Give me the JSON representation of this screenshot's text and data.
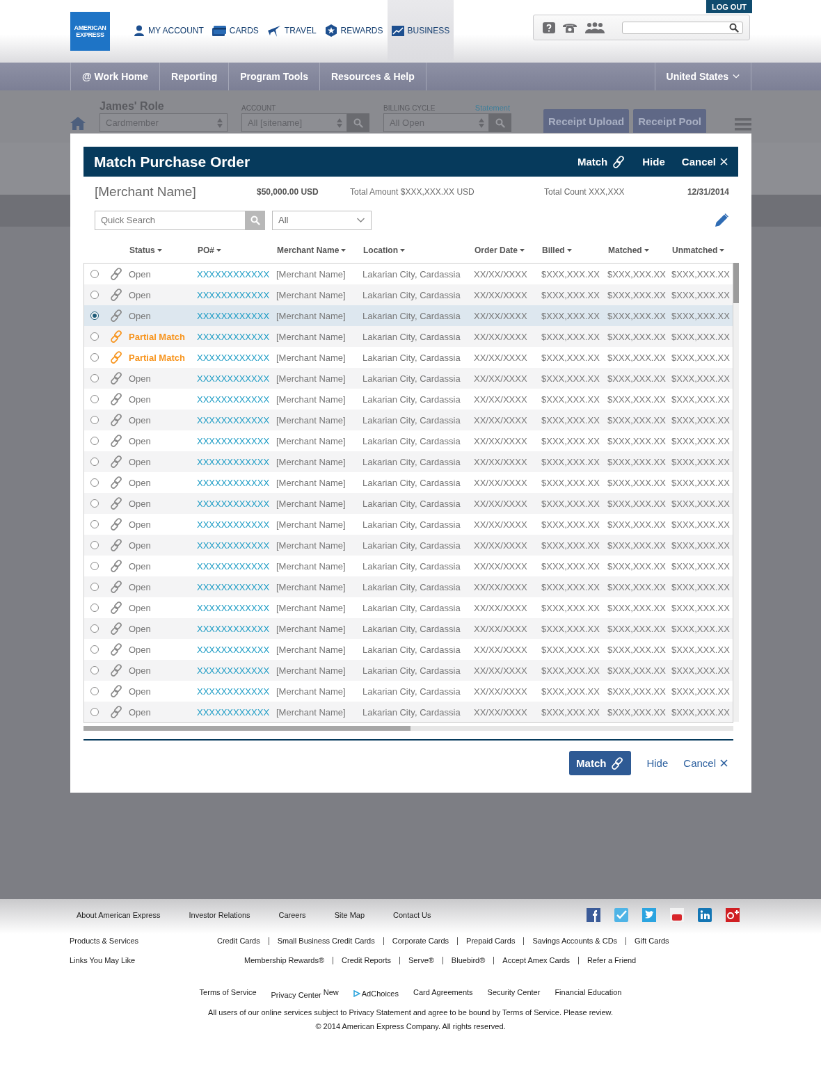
{
  "header": {
    "logo": [
      "AMERICAN",
      "EXPRESS"
    ],
    "logout": "LOG OUT",
    "nav": [
      {
        "label": "MY ACCOUNT",
        "selected": false
      },
      {
        "label": "CARDS",
        "selected": false
      },
      {
        "label": "TRAVEL",
        "selected": false
      },
      {
        "label": "REWARDS",
        "selected": false
      },
      {
        "label": "BUSINESS",
        "selected": true
      }
    ]
  },
  "main_nav": {
    "items": [
      "@ Work Home",
      "Reporting",
      "Program Tools",
      "Resources & Help"
    ],
    "region": "United States"
  },
  "toolbar": {
    "role_title": "James' Role",
    "role_select": "Cardmember",
    "account_label": "ACCOUNT",
    "account_select": "All [sitename]",
    "billing_label": "BILLING CYCLE",
    "statement_link": "Statement",
    "billing_select": "All Open",
    "buttons": [
      "Receipt Upload",
      "Receipt Pool"
    ]
  },
  "modal": {
    "title": "Match Purchase Order",
    "actions": [
      {
        "label": "Match",
        "kind": "link-icon"
      },
      {
        "label": "Hide",
        "kind": "plain"
      },
      {
        "label": "Cancel",
        "kind": "cancel"
      }
    ],
    "summary": {
      "merchant": "[Merchant Name]",
      "amount": "$50,000.00 USD",
      "total_amount": "Total Amount $XXX,XXX.XX USD",
      "total_count": "Total Count XXX,XXX",
      "date": "12/31/2014"
    },
    "search": {
      "placeholder": "Quick Search"
    },
    "filter": "All",
    "columns": [
      "Status",
      "PO#",
      "Merchant Name",
      "Location",
      "Order Date",
      "Billed",
      "Matched",
      "Unmatched"
    ],
    "rows": [
      {
        "selected": false,
        "kind": "open",
        "status": "Open",
        "po": "XXXXXXXXXXXX",
        "merchant": "[Merchant Name]",
        "location": "Lakarian City, Cardassia",
        "order_date": "XX/XX/XXXX",
        "billed": "$XXX,XXX.XX",
        "matched": "$XXX,XXX.XX",
        "unmatched": "$XXX,XXX.XX"
      },
      {
        "selected": false,
        "kind": "open",
        "status": "Open",
        "po": "XXXXXXXXXXXX",
        "merchant": "[Merchant Name]",
        "location": "Lakarian City, Cardassia",
        "order_date": "XX/XX/XXXX",
        "billed": "$XXX,XXX.XX",
        "matched": "$XXX,XXX.XX",
        "unmatched": "$XXX,XXX.XX"
      },
      {
        "selected": true,
        "kind": "open",
        "status": "Open",
        "po": "XXXXXXXXXXXX",
        "merchant": "[Merchant Name]",
        "location": "Lakarian City, Cardassia",
        "order_date": "XX/XX/XXXX",
        "billed": "$XXX,XXX.XX",
        "matched": "$XXX,XXX.XX",
        "unmatched": "$XXX,XXX.XX"
      },
      {
        "selected": false,
        "kind": "partial",
        "status": "Partial Match",
        "po": "XXXXXXXXXXXX",
        "merchant": "[Merchant Name]",
        "location": "Lakarian City, Cardassia",
        "order_date": "XX/XX/XXXX",
        "billed": "$XXX,XXX.XX",
        "matched": "$XXX,XXX.XX",
        "unmatched": "$XXX,XXX.XX"
      },
      {
        "selected": false,
        "kind": "partial",
        "status": "Partial Match",
        "po": "XXXXXXXXXXXX",
        "merchant": "[Merchant Name]",
        "location": "Lakarian City, Cardassia",
        "order_date": "XX/XX/XXXX",
        "billed": "$XXX,XXX.XX",
        "matched": "$XXX,XXX.XX",
        "unmatched": "$XXX,XXX.XX"
      },
      {
        "selected": false,
        "kind": "open",
        "status": "Open",
        "po": "XXXXXXXXXXXX",
        "merchant": "[Merchant Name]",
        "location": "Lakarian City, Cardassia",
        "order_date": "XX/XX/XXXX",
        "billed": "$XXX,XXX.XX",
        "matched": "$XXX,XXX.XX",
        "unmatched": "$XXX,XXX.XX"
      },
      {
        "selected": false,
        "kind": "open",
        "status": "Open",
        "po": "XXXXXXXXXXXX",
        "merchant": "[Merchant Name]",
        "location": "Lakarian City, Cardassia",
        "order_date": "XX/XX/XXXX",
        "billed": "$XXX,XXX.XX",
        "matched": "$XXX,XXX.XX",
        "unmatched": "$XXX,XXX.XX"
      },
      {
        "selected": false,
        "kind": "open",
        "status": "Open",
        "po": "XXXXXXXXXXXX",
        "merchant": "[Merchant Name]",
        "location": "Lakarian City, Cardassia",
        "order_date": "XX/XX/XXXX",
        "billed": "$XXX,XXX.XX",
        "matched": "$XXX,XXX.XX",
        "unmatched": "$XXX,XXX.XX"
      },
      {
        "selected": false,
        "kind": "open",
        "status": "Open",
        "po": "XXXXXXXXXXXX",
        "merchant": "[Merchant Name]",
        "location": "Lakarian City, Cardassia",
        "order_date": "XX/XX/XXXX",
        "billed": "$XXX,XXX.XX",
        "matched": "$XXX,XXX.XX",
        "unmatched": "$XXX,XXX.XX"
      },
      {
        "selected": false,
        "kind": "open",
        "status": "Open",
        "po": "XXXXXXXXXXXX",
        "merchant": "[Merchant Name]",
        "location": "Lakarian City, Cardassia",
        "order_date": "XX/XX/XXXX",
        "billed": "$XXX,XXX.XX",
        "matched": "$XXX,XXX.XX",
        "unmatched": "$XXX,XXX.XX"
      },
      {
        "selected": false,
        "kind": "open",
        "status": "Open",
        "po": "XXXXXXXXXXXX",
        "merchant": "[Merchant Name]",
        "location": "Lakarian City, Cardassia",
        "order_date": "XX/XX/XXXX",
        "billed": "$XXX,XXX.XX",
        "matched": "$XXX,XXX.XX",
        "unmatched": "$XXX,XXX.XX"
      },
      {
        "selected": false,
        "kind": "open",
        "status": "Open",
        "po": "XXXXXXXXXXXX",
        "merchant": "[Merchant Name]",
        "location": "Lakarian City, Cardassia",
        "order_date": "XX/XX/XXXX",
        "billed": "$XXX,XXX.XX",
        "matched": "$XXX,XXX.XX",
        "unmatched": "$XXX,XXX.XX"
      },
      {
        "selected": false,
        "kind": "open",
        "status": "Open",
        "po": "XXXXXXXXXXXX",
        "merchant": "[Merchant Name]",
        "location": "Lakarian City, Cardassia",
        "order_date": "XX/XX/XXXX",
        "billed": "$XXX,XXX.XX",
        "matched": "$XXX,XXX.XX",
        "unmatched": "$XXX,XXX.XX"
      },
      {
        "selected": false,
        "kind": "open",
        "status": "Open",
        "po": "XXXXXXXXXXXX",
        "merchant": "[Merchant Name]",
        "location": "Lakarian City, Cardassia",
        "order_date": "XX/XX/XXXX",
        "billed": "$XXX,XXX.XX",
        "matched": "$XXX,XXX.XX",
        "unmatched": "$XXX,XXX.XX"
      },
      {
        "selected": false,
        "kind": "open",
        "status": "Open",
        "po": "XXXXXXXXXXXX",
        "merchant": "[Merchant Name]",
        "location": "Lakarian City, Cardassia",
        "order_date": "XX/XX/XXXX",
        "billed": "$XXX,XXX.XX",
        "matched": "$XXX,XXX.XX",
        "unmatched": "$XXX,XXX.XX"
      },
      {
        "selected": false,
        "kind": "open",
        "status": "Open",
        "po": "XXXXXXXXXXXX",
        "merchant": "[Merchant Name]",
        "location": "Lakarian City, Cardassia",
        "order_date": "XX/XX/XXXX",
        "billed": "$XXX,XXX.XX",
        "matched": "$XXX,XXX.XX",
        "unmatched": "$XXX,XXX.XX"
      },
      {
        "selected": false,
        "kind": "open",
        "status": "Open",
        "po": "XXXXXXXXXXXX",
        "merchant": "[Merchant Name]",
        "location": "Lakarian City, Cardassia",
        "order_date": "XX/XX/XXXX",
        "billed": "$XXX,XXX.XX",
        "matched": "$XXX,XXX.XX",
        "unmatched": "$XXX,XXX.XX"
      },
      {
        "selected": false,
        "kind": "open",
        "status": "Open",
        "po": "XXXXXXXXXXXX",
        "merchant": "[Merchant Name]",
        "location": "Lakarian City, Cardassia",
        "order_date": "XX/XX/XXXX",
        "billed": "$XXX,XXX.XX",
        "matched": "$XXX,XXX.XX",
        "unmatched": "$XXX,XXX.XX"
      },
      {
        "selected": false,
        "kind": "open",
        "status": "Open",
        "po": "XXXXXXXXXXXX",
        "merchant": "[Merchant Name]",
        "location": "Lakarian City, Cardassia",
        "order_date": "XX/XX/XXXX",
        "billed": "$XXX,XXX.XX",
        "matched": "$XXX,XXX.XX",
        "unmatched": "$XXX,XXX.XX"
      },
      {
        "selected": false,
        "kind": "open",
        "status": "Open",
        "po": "XXXXXXXXXXXX",
        "merchant": "[Merchant Name]",
        "location": "Lakarian City, Cardassia",
        "order_date": "XX/XX/XXXX",
        "billed": "$XXX,XXX.XX",
        "matched": "$XXX,XXX.XX",
        "unmatched": "$XXX,XXX.XX"
      },
      {
        "selected": false,
        "kind": "open",
        "status": "Open",
        "po": "XXXXXXXXXXXX",
        "merchant": "[Merchant Name]",
        "location": "Lakarian City, Cardassia",
        "order_date": "XX/XX/XXXX",
        "billed": "$XXX,XXX.XX",
        "matched": "$XXX,XXX.XX",
        "unmatched": "$XXX,XXX.XX"
      },
      {
        "selected": false,
        "kind": "open",
        "status": "Open",
        "po": "XXXXXXXXXXXX",
        "merchant": "[Merchant Name]",
        "location": "Lakarian City, Cardassia",
        "order_date": "XX/XX/XXXX",
        "billed": "$XXX,XXX.XX",
        "matched": "$XXX,XXX.XX",
        "unmatched": "$XXX,XXX.XX"
      }
    ],
    "bottom_actions": [
      {
        "label": "Match",
        "kind": "primary"
      },
      {
        "label": "Hide",
        "kind": "plain"
      },
      {
        "label": "Cancel",
        "kind": "cancel"
      }
    ]
  },
  "footer": {
    "top_links": [
      "About American Express",
      "Investor Relations",
      "Careers",
      "Site Map",
      "Contact Us"
    ],
    "products_label": "Products & Services",
    "products": [
      "Credit Cards",
      "Small Business Credit Cards",
      "Corporate Cards",
      "Prepaid Cards",
      "Savings Accounts & CDs",
      "Gift Cards"
    ],
    "links_label": "Links You May Like",
    "links": [
      "Membership Rewards®",
      "Credit Reports",
      "Serve®",
      "Bluebird®",
      "Accept Amex Cards",
      "Refer a Friend"
    ],
    "legal": [
      {
        "label": "Terms of Service",
        "kind": "link"
      },
      {
        "label": "Privacy Center $^{New}$",
        "kind": "link"
      },
      {
        "label": "AdChoices",
        "kind": "icon-link"
      },
      {
        "label": "Card Agreements",
        "kind": "link"
      },
      {
        "label": "Security Center",
        "kind": "link"
      },
      {
        "label": "Financial Education",
        "kind": "link"
      }
    ],
    "notice": "All users of our online services subject to Privacy Statement and agree to be bound by Terms of Service. Please review.",
    "copyright": "© 2014 American Express Company. All rights reserved."
  }
}
